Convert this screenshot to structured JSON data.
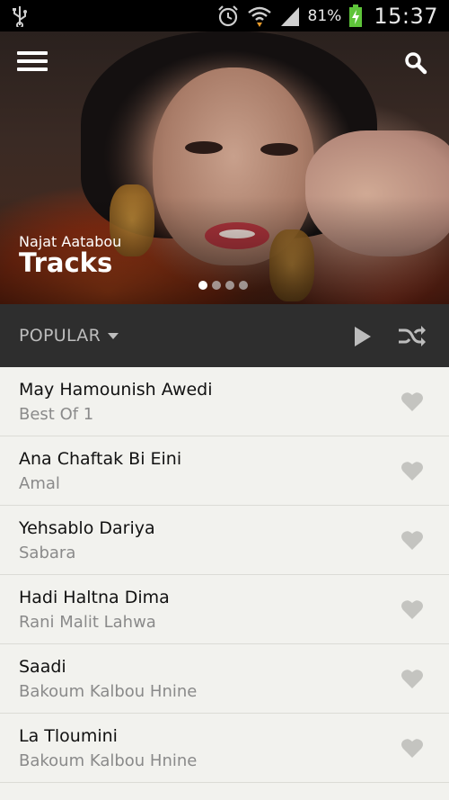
{
  "status_bar": {
    "icons": [
      "usb-icon",
      "alarm-icon",
      "wifi-icon",
      "signal-icon",
      "battery-charging-icon"
    ],
    "battery": "81%",
    "time": "15:37"
  },
  "hero": {
    "artist": "Najat Aatabou",
    "title": "Tracks",
    "page_count": 4,
    "active_page": 1
  },
  "controls": {
    "sort_label": "POPULAR"
  },
  "tracks": [
    {
      "name": "May Hamounish Awedi",
      "album": "Best Of 1"
    },
    {
      "name": "Ana Chaftak Bi Eini",
      "album": "Amal"
    },
    {
      "name": "Yehsablo Dariya",
      "album": "Sabara"
    },
    {
      "name": "Hadi Haltna Dima",
      "album": "Rani Malit Lahwa"
    },
    {
      "name": "Saadi",
      "album": "Bakoum Kalbou Hnine"
    },
    {
      "name": "La Tloumini",
      "album": "Bakoum Kalbou Hnine"
    }
  ],
  "colors": {
    "status_bar_bg": "#000000",
    "controls_bg": "#2e2e2e",
    "list_bg": "#f2f2ee",
    "heart_color": "#c4c4c0"
  }
}
